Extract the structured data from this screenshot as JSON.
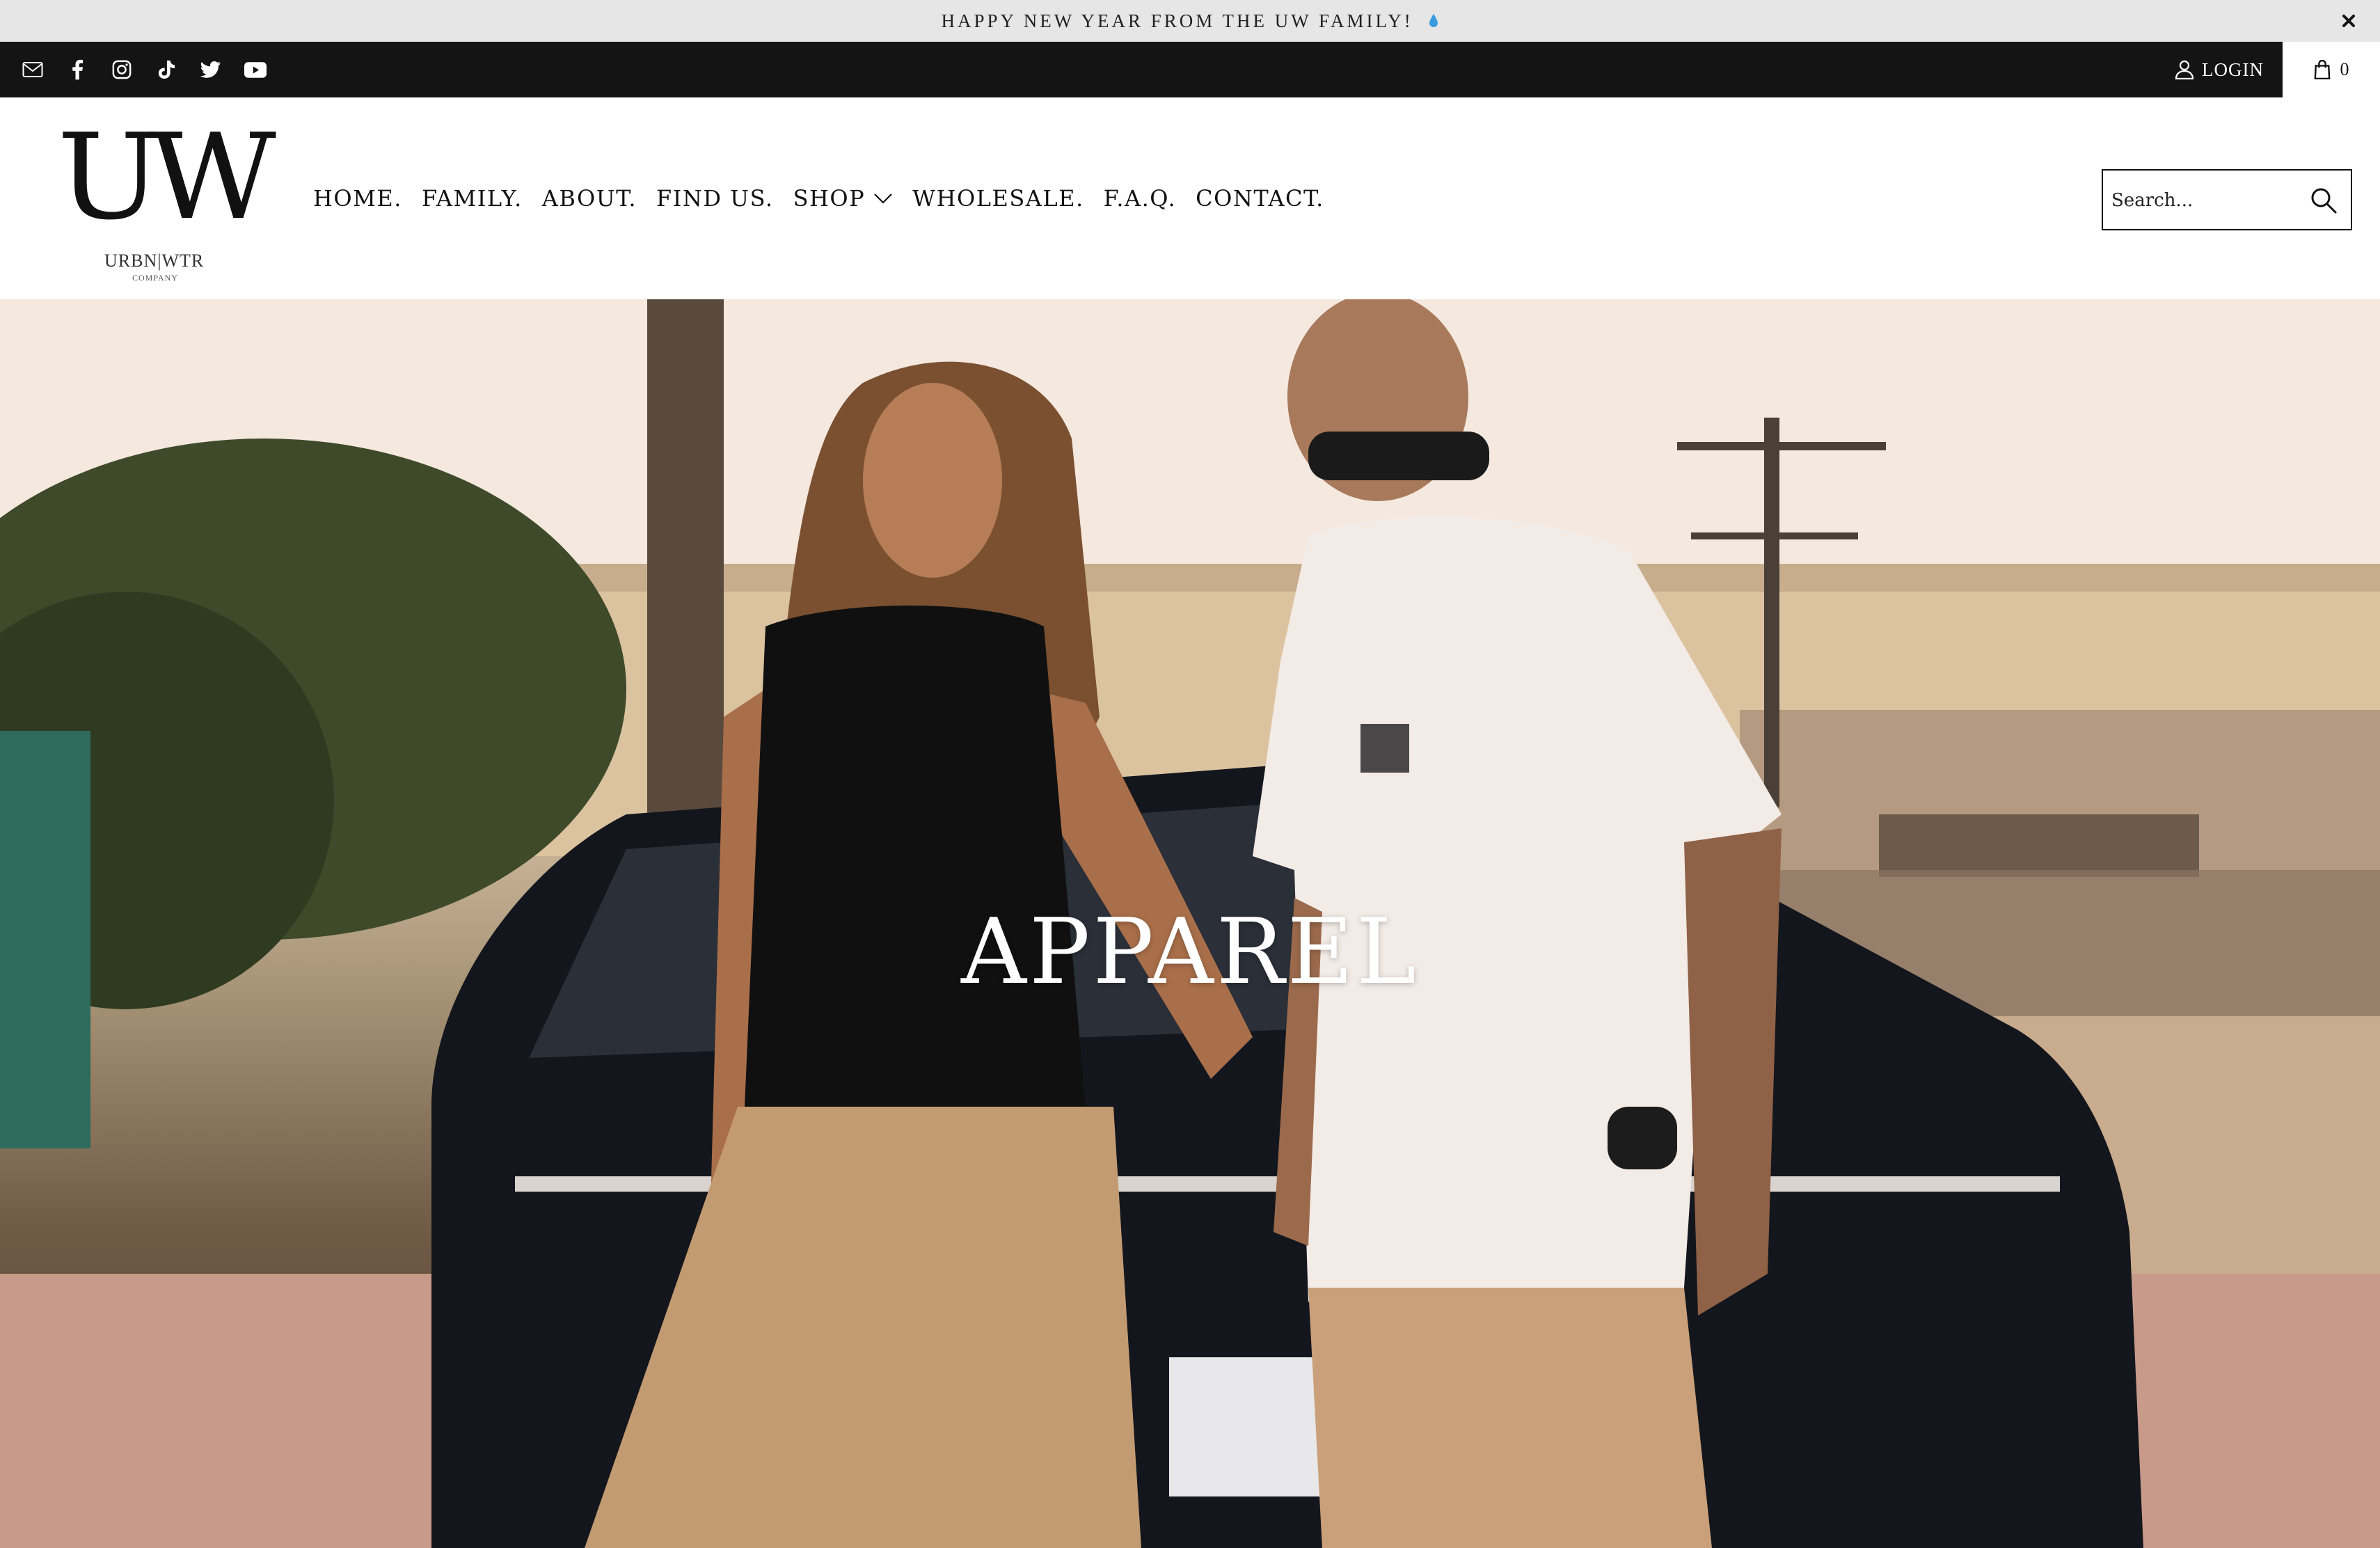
{
  "announcement": {
    "text": "HAPPY NEW YEAR FROM THE UW FAMILY!",
    "emoji_icon": "droplet-icon"
  },
  "topbar": {
    "social_icons": [
      "mail-icon",
      "facebook-icon",
      "instagram-icon",
      "tiktok-icon",
      "twitter-icon",
      "youtube-icon"
    ],
    "login_label": "LOGIN",
    "cart_count": "0"
  },
  "logo": {
    "mark": "UW",
    "name": "URBN|WTR",
    "sub": "COMPANY"
  },
  "nav": {
    "items": [
      {
        "label": "HOME."
      },
      {
        "label": "FAMILY."
      },
      {
        "label": "ABOUT."
      },
      {
        "label": "FIND US."
      },
      {
        "label": "SHOP"
      },
      {
        "label": "WHOLESALE."
      },
      {
        "label": "F.A.Q."
      },
      {
        "label": "CONTACT."
      }
    ]
  },
  "search": {
    "placeholder": "Search..."
  },
  "hero": {
    "title": "APPAREL"
  },
  "colors": {
    "topbar": "#141414",
    "announcement_bg": "#e6e6e6",
    "hero_text": "#ffffff"
  }
}
